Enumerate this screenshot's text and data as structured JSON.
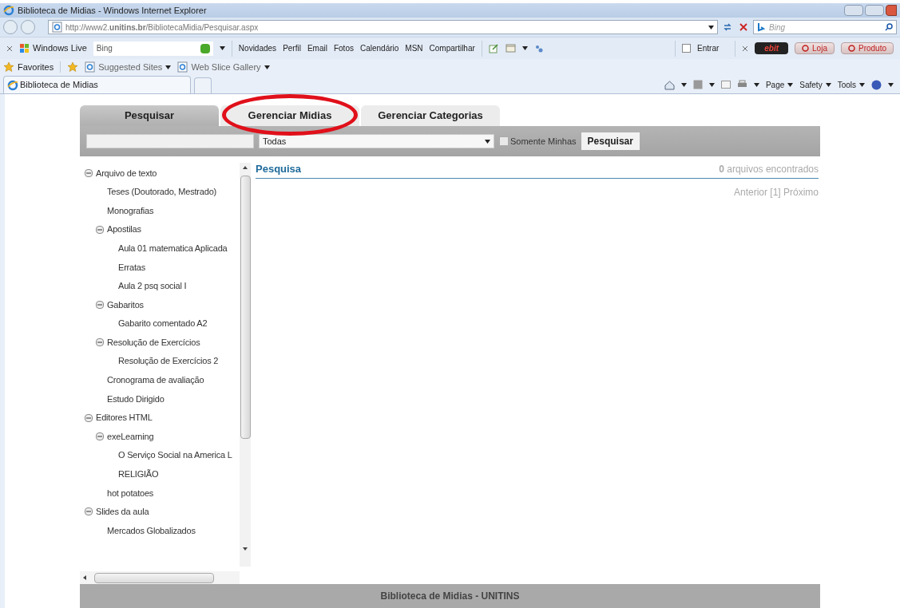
{
  "window": {
    "title": "Biblioteca de Midias - Windows Internet Explorer"
  },
  "address_bar": {
    "url": "http://www2.**unitins.br**/BibliotecaMidia/Pesquisar.aspx",
    "search_placeholder": "Bing"
  },
  "links_toolbar": {
    "brand": "Windows Live",
    "search_value": "Bing",
    "links": [
      "Novidades",
      "Perfil",
      "Email",
      "Fotos",
      "Calendário",
      "MSN",
      "Compartilhar"
    ],
    "signin": "Entrar",
    "badges": [
      "ebit",
      "Loja",
      "Produto"
    ]
  },
  "favorites_bar": {
    "label": "Favorites",
    "items": [
      "Suggested Sites",
      "Web Slice Gallery"
    ]
  },
  "browser_tabs": [
    {
      "label": "Biblioteca de Midias",
      "selected": true
    }
  ],
  "command_bar": [
    "Page",
    "Safety",
    "Tools"
  ],
  "page_tabs": [
    {
      "label": "Pesquisar",
      "selected": true,
      "circled": false
    },
    {
      "label": "Gerenciar Midias",
      "selected": false,
      "circled": true
    },
    {
      "label": "Gerenciar Categorias",
      "selected": false,
      "circled": false
    }
  ],
  "search_bar": {
    "category": "Todas",
    "only_mine_label": "Somente Minhas",
    "only_mine_checked": false,
    "button": "Pesquisar"
  },
  "tree": [
    {
      "label": "Arquivo de texto",
      "expanded": true,
      "children": [
        {
          "label": "Teses (Doutorado, Mestrado)"
        },
        {
          "label": "Monografias"
        },
        {
          "label": "Apostilas",
          "expanded": true,
          "children": [
            {
              "label": "Aula 01 matematica Aplicada"
            },
            {
              "label": "Erratas"
            },
            {
              "label": "Aula 2 psq social I"
            }
          ]
        },
        {
          "label": "Gabaritos",
          "expanded": true,
          "children": [
            {
              "label": "Gabarito comentado A2"
            }
          ]
        },
        {
          "label": "Resolução de Exercícios",
          "expanded": true,
          "children": [
            {
              "label": "Resolução de Exercícios 2"
            }
          ]
        },
        {
          "label": "Cronograma de avaliação"
        },
        {
          "label": "Estudo Dirigido"
        }
      ]
    },
    {
      "label": "Editores HTML",
      "expanded": true,
      "children": [
        {
          "label": "exeLearning",
          "expanded": true,
          "children": [
            {
              "label": "O Serviço Social na America L"
            },
            {
              "label": "RELIGIÃO"
            }
          ]
        },
        {
          "label": "hot potatoes"
        }
      ]
    },
    {
      "label": "Slides da aula",
      "expanded": true,
      "children": [
        {
          "label": "Mercados Globalizados"
        }
      ]
    }
  ],
  "results": {
    "title": "Pesquisa",
    "count": "**0** arquivos encontrados",
    "pager": "Anterior [1] Próximo"
  },
  "footer": "Biblioteca de Midias - UNITINS"
}
